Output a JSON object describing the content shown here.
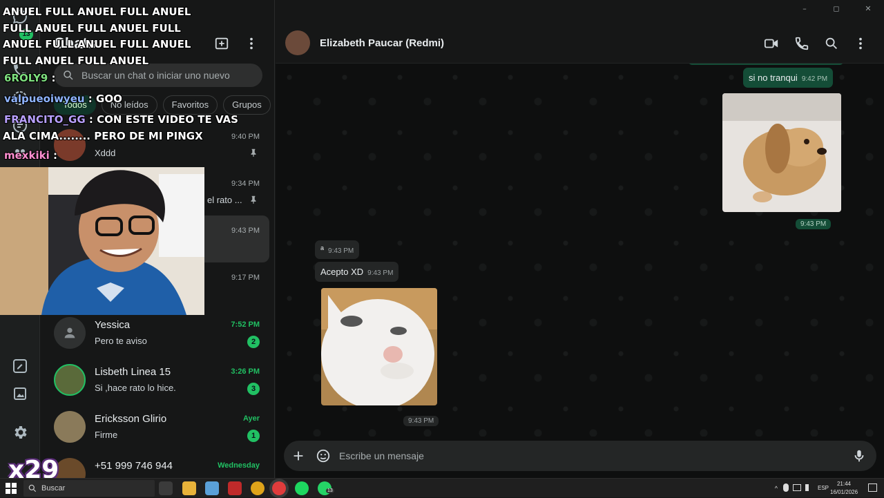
{
  "window": {
    "min": "–",
    "max": "◻",
    "close": "✕"
  },
  "rail": {
    "chats_badge": "13"
  },
  "sidebar": {
    "title": "Chats",
    "search_placeholder": "Buscar un chat o iniciar uno nuevo",
    "filters": [
      "Todos",
      "No leídos",
      "Favoritos",
      "Grupos"
    ],
    "chats": [
      {
        "name": "",
        "preview": "Xddd",
        "time": "9:40 PM",
        "unread": "",
        "pinned": true
      },
      {
        "name": "",
        "preview": "el rato ...",
        "time": "9:34 PM",
        "unread": "",
        "pinned": true
      },
      {
        "name": "",
        "preview": "",
        "time": "9:43 PM",
        "unread": "",
        "pinned": false
      },
      {
        "name": "",
        "preview": "",
        "time": "9:17 PM",
        "unread": "",
        "pinned": false
      },
      {
        "name": "Yessica",
        "preview": "Pero te aviso",
        "time": "7:52 PM",
        "unread": "2",
        "pinned": false
      },
      {
        "name": "Lisbeth Linea 15",
        "preview": "Si ,hace rato lo hice.",
        "time": "3:26 PM",
        "unread": "3",
        "pinned": false
      },
      {
        "name": "Ericksson Glirio",
        "preview": "Firme",
        "time": "Ayer",
        "unread": "1",
        "pinned": false
      },
      {
        "name": "+51 999 746 944",
        "preview": "",
        "time": "Wednesday",
        "unread": "",
        "pinned": false
      }
    ]
  },
  "conversation": {
    "contact_name": "Elizabeth Paucar (Redmi)",
    "messages": [
      {
        "dir": "out",
        "text": "si no tranqui",
        "time": "9:42 PM"
      },
      {
        "dir": "out",
        "kind": "image",
        "subject": "dog",
        "time": "9:43 PM"
      },
      {
        "dir": "in",
        "text": "a",
        "time": "9:43 PM"
      },
      {
        "dir": "in",
        "text": "Acepto XD",
        "time": "9:43 PM"
      },
      {
        "dir": "in",
        "kind": "image",
        "subject": "cat",
        "time": "9:43 PM"
      }
    ],
    "composer_placeholder": "Escribe un mensaje"
  },
  "stream_overlay": {
    "banner": "ANUEL FULL ANUEL FULL ANUEL FULL ANUEL FULL ANUEL FULL ANUEL FULL ANUEL FULL ANUEL FULL ANUEL FULL ANUEL",
    "chat": [
      {
        "user": "6ROLY9",
        "sep": " :",
        "msg": ""
      },
      {
        "user": "valpueoiwyeu",
        "sep": " :",
        "msg": " GOO"
      },
      {
        "user": "FRANCITO_GG",
        "sep": " :",
        "msg": " CON ESTE VIDEO TE VAS"
      },
      {
        "user": "",
        "sep": "",
        "msg": "ALA CIMA........ PERO DE MI PINGX"
      },
      {
        "user": "mexkiki",
        "sep": " :",
        "msg": ""
      }
    ],
    "multiplier": "x29"
  },
  "taskbar": {
    "search_label": "Buscar",
    "whatsapp_badge": "13",
    "lang": "ESP",
    "time": "21:44",
    "date": "16/01/2026"
  },
  "colors": {
    "accent": "#21c063",
    "outgoing_bubble": "#144d37",
    "incoming_bubble": "#242626",
    "background": "#161717"
  }
}
